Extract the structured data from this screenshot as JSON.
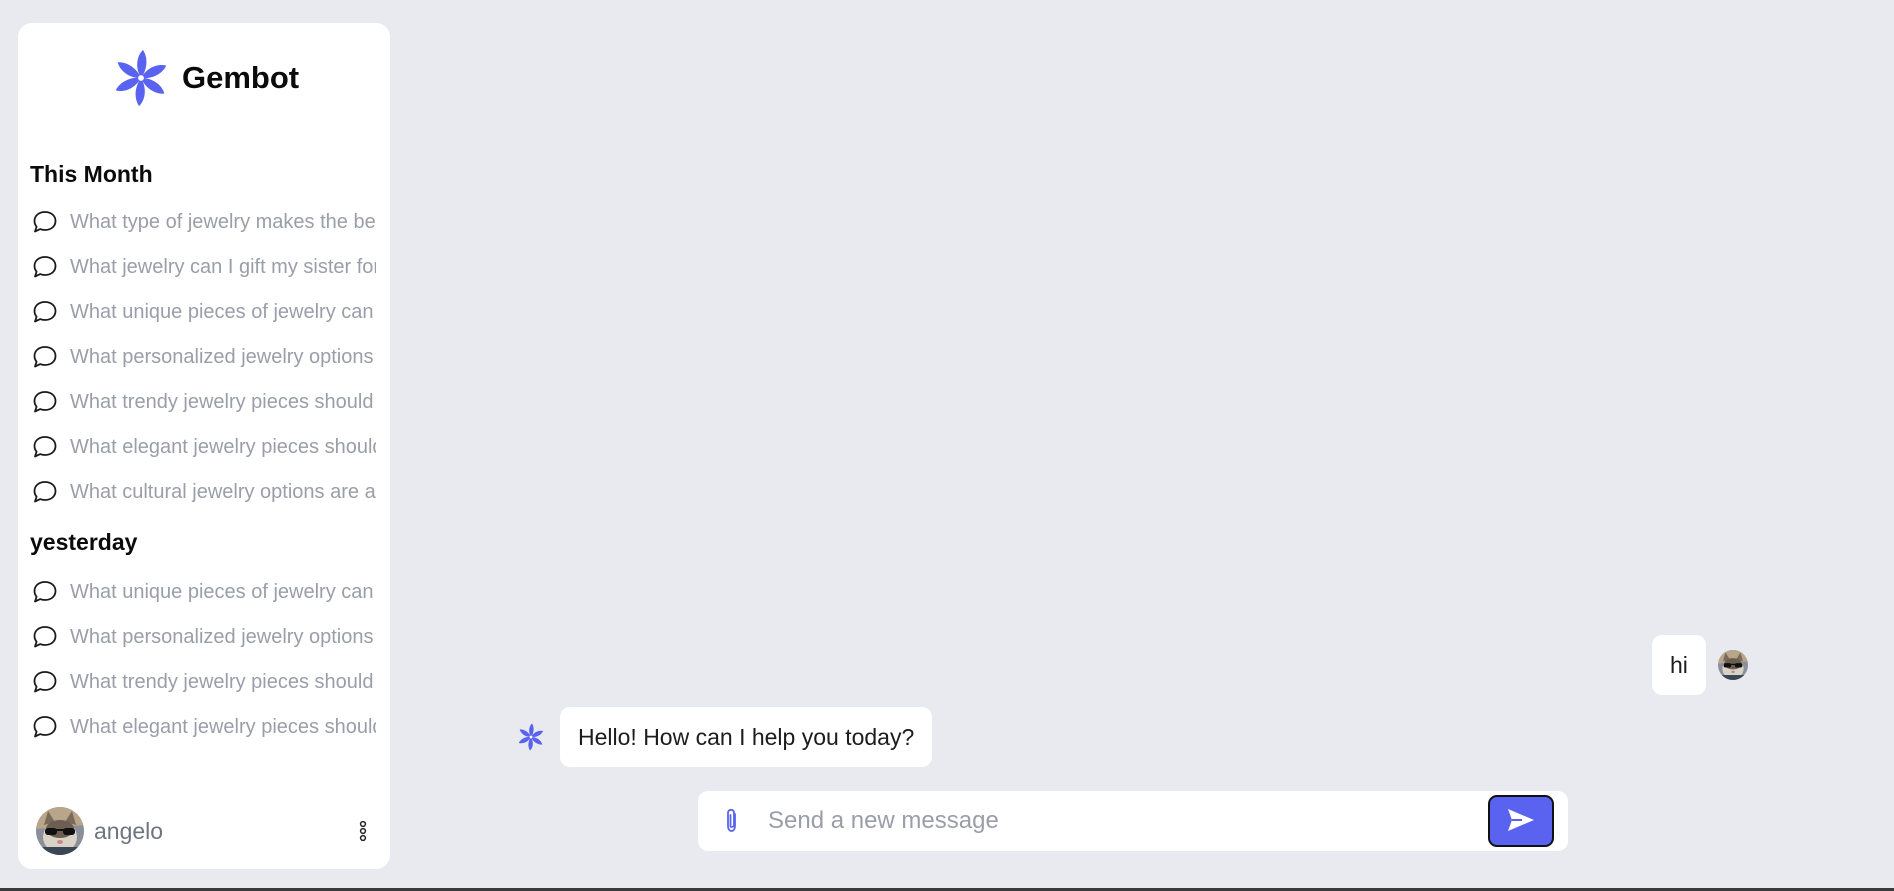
{
  "brand": {
    "name": "Gembot",
    "icon": "pinwheel-flower-icon",
    "accent_color": "#5a63f0"
  },
  "sidebar": {
    "sections": [
      {
        "title": "This Month",
        "items": [
          "What type of jewelry makes the best gift",
          "What jewelry can I gift my sister for her birthday",
          "What unique pieces of jewelry can I give",
          "What personalized jewelry options are there",
          "What trendy jewelry pieces should I consider",
          "What elegant jewelry pieces should I choose",
          "What cultural jewelry options are available"
        ]
      },
      {
        "title": "yesterday",
        "items": [
          "What unique pieces of jewelry can I give",
          "What personalized jewelry options are there",
          "What trendy jewelry pieces should I consider",
          "What elegant jewelry pieces should I choose"
        ]
      }
    ],
    "item_icon": "chat-bubble-icon"
  },
  "user": {
    "name": "angelo",
    "avatar": "cat-with-sunglasses-avatar",
    "menu_icon": "vertical-dots-icon"
  },
  "conversation": {
    "messages": [
      {
        "role": "user",
        "text": "hi"
      },
      {
        "role": "assistant",
        "text": "Hello! How can I help you today?"
      }
    ]
  },
  "composer": {
    "placeholder": "Send a new message",
    "value": "",
    "attach_icon": "paperclip-icon",
    "send_icon": "send-arrow-icon"
  },
  "colors": {
    "background": "#e8eaef",
    "panel": "#ffffff",
    "muted_text": "#9a9ea8"
  }
}
